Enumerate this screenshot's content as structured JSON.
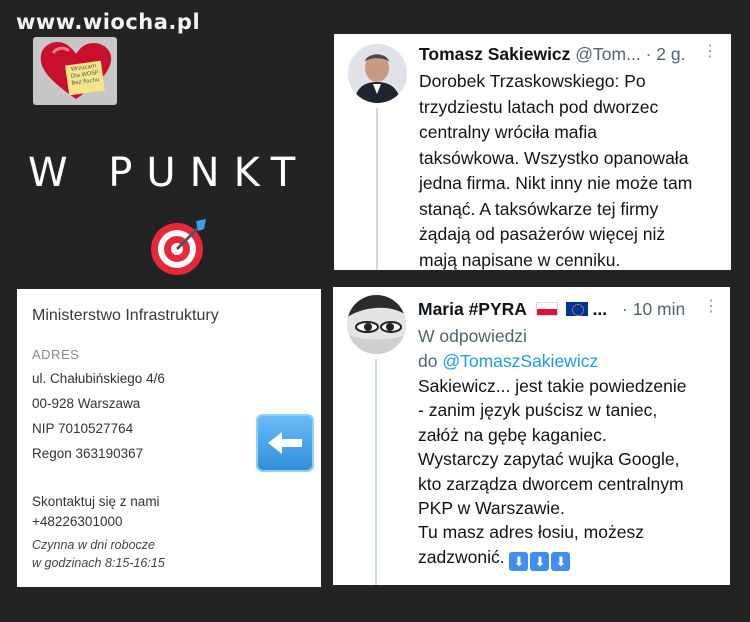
{
  "site": {
    "logo": "www.wiocha.pl"
  },
  "thumbnail": {
    "note": "Wrzucam Dla WOŚP Bez Fochu",
    "icon": "heart-icon"
  },
  "headline": "W PUNKT",
  "target_icon": "direct-hit-target-icon",
  "tweet1": {
    "name": "Tomasz Sakiewicz",
    "handle": "@Tom...",
    "time": "· 2 g.",
    "body": "Dorobek Trzaskowskiego: Po\ntrzydziestu latach pod dworzec\ncentralny wróciła mafia\ntaksówkowa. Wszystko opanowała\njedna firma. Nikt inny nie może tam\nstanąć. A taksówkarze tej firmy\nżądają od pasażerów więcej niż\nmają napisane w cenniku."
  },
  "tweet2": {
    "name": "Maria #PYRA",
    "name_suffix": "...",
    "time": "· 10 min",
    "reply_prefix": "W odpowiedzi",
    "reply_do": "do",
    "reply_handle": "@TomaszSakiewicz",
    "body": "Sakiewicz... jest takie powiedzenie\n- zanim język puścisz w taniec,\nzałóż na gębę kaganiec.\nWystarczy zapytać wujka Google,\nkto zarządza dworcem centralnym\nPKP w Warszawie.\nTu masz adres łosiu, możesz\nzadzwonić.",
    "arrows": [
      "⬇",
      "⬇",
      "⬇"
    ]
  },
  "more_icon": "⋮",
  "info": {
    "title": "Ministerstwo Infrastruktury",
    "address_label": "ADRES",
    "street": "ul. Chałubińskiego 4/6",
    "city": "00-928 Warszawa",
    "nip": "NIP 7010527764",
    "regon": "Regon 363190367",
    "contact": "Skontaktuj się z nami",
    "phone": "+48226301000",
    "hours_line1": "Czynna w dni robocze",
    "hours_line2": "w godzinach 8:15-16:15"
  },
  "back_arrow_icon": "left-arrow-icon",
  "colors": {
    "background": "#232323",
    "link": "#1d9bf0",
    "muted": "#536471",
    "arrow_blue": "#3f8ef0"
  }
}
